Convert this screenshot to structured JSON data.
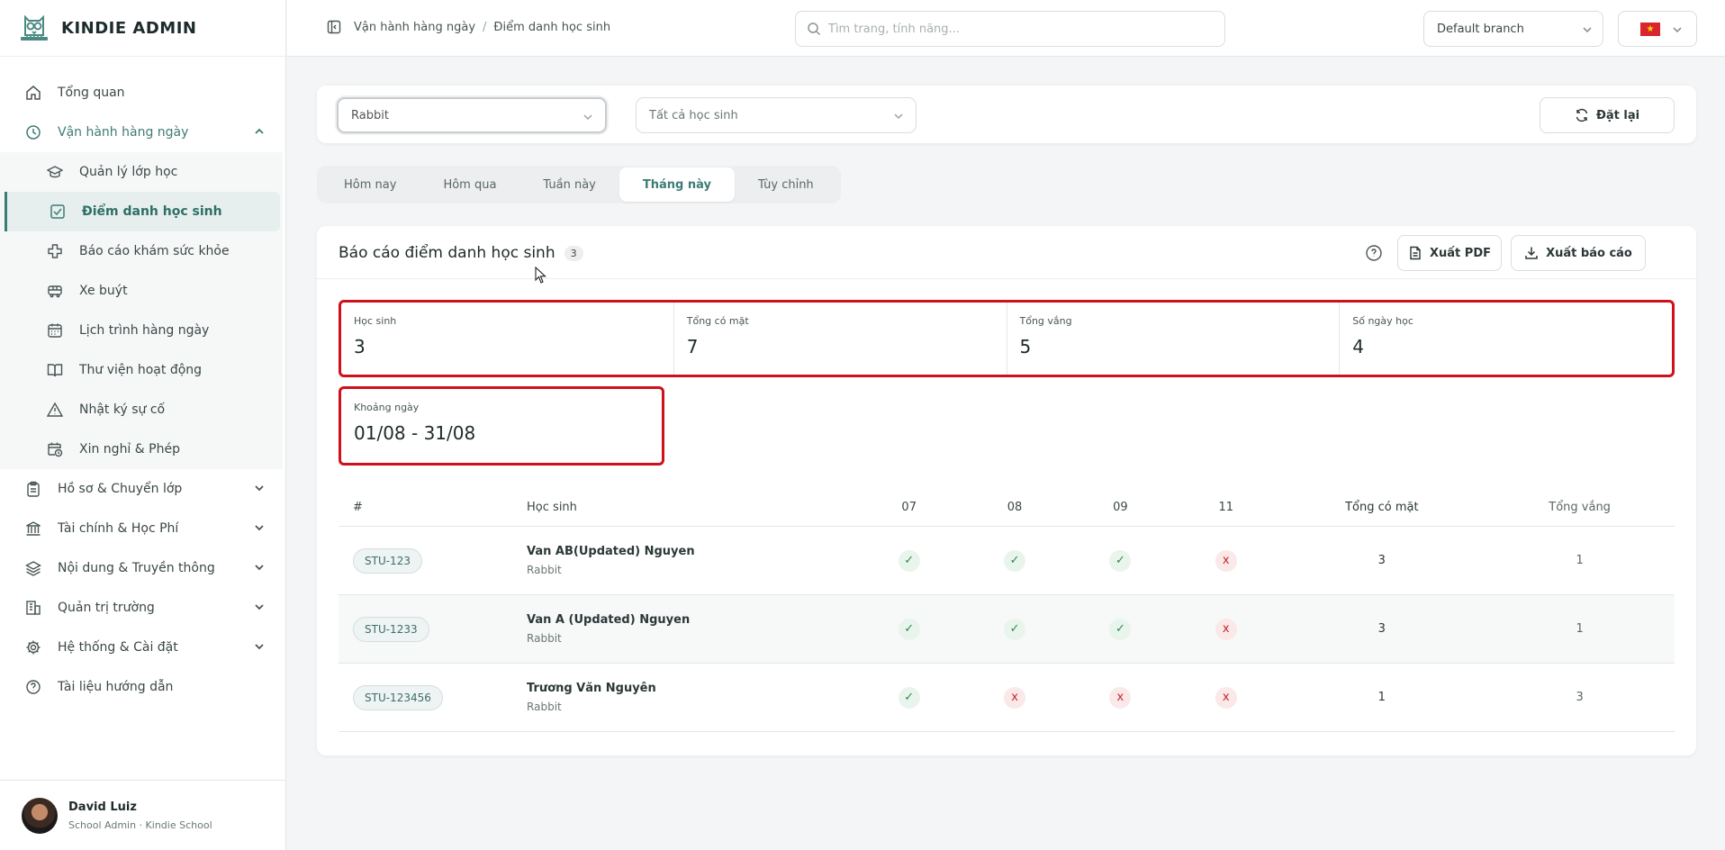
{
  "brand": {
    "name": "KINDIE ADMIN"
  },
  "sidebar": {
    "items": [
      {
        "label": "Tổng quan",
        "icon": "home-icon"
      },
      {
        "label": "Vận hành hàng ngày",
        "icon": "clock-icon",
        "open": true,
        "children": [
          {
            "label": "Quản lý lớp học",
            "icon": "graduation-cap-icon"
          },
          {
            "label": "Điểm danh học sinh",
            "icon": "check-square-icon",
            "active": true
          },
          {
            "label": "Báo cáo khám sức khỏe",
            "icon": "health-cross-icon"
          },
          {
            "label": "Xe buýt",
            "icon": "bus-icon"
          },
          {
            "label": "Lịch trình hàng ngày",
            "icon": "calendar-icon"
          },
          {
            "label": "Thư viện hoạt động",
            "icon": "book-icon"
          },
          {
            "label": "Nhật ký sự cố",
            "icon": "warning-icon"
          },
          {
            "label": "Xin nghỉ & Phép",
            "icon": "calendar-clock-icon"
          }
        ]
      },
      {
        "label": "Hồ sơ & Chuyển lớp",
        "icon": "clipboard-icon"
      },
      {
        "label": "Tài chính & Học Phí",
        "icon": "bank-icon"
      },
      {
        "label": "Nội dung & Truyền thông",
        "icon": "layers-icon"
      },
      {
        "label": "Quản trị trường",
        "icon": "building-icon"
      },
      {
        "label": "Hệ thống & Cài đặt",
        "icon": "gear-icon"
      },
      {
        "label": "Tài liệu hướng dẫn",
        "icon": "help-circle-icon"
      }
    ]
  },
  "user": {
    "name": "David Luiz",
    "role": "School Admin · Kindie School"
  },
  "header": {
    "breadcrumb": [
      "Vận hành hàng ngày",
      "Điểm danh học sinh"
    ],
    "search_placeholder": "Tìm trang, tính năng...",
    "branch": "Default branch",
    "flag_color": "#d8262c"
  },
  "filters": {
    "class_value": "Rabbit",
    "student_value": "Tất cả học sinh",
    "reset_label": "Đặt lại"
  },
  "tabs": [
    {
      "label": "Hôm nay"
    },
    {
      "label": "Hôm qua"
    },
    {
      "label": "Tuần này"
    },
    {
      "label": "Tháng này",
      "active": true
    },
    {
      "label": "Tùy chỉnh"
    }
  ],
  "report": {
    "title": "Báo cáo điểm danh học sinh",
    "count": "3",
    "pdf_label": "Xuất PDF",
    "export_label": "Xuất báo cáo",
    "stats": [
      {
        "label": "Học sinh",
        "value": "3"
      },
      {
        "label": "Tổng có mặt",
        "value": "7"
      },
      {
        "label": "Tổng vắng",
        "value": "5"
      },
      {
        "label": "Số ngày học",
        "value": "4"
      }
    ],
    "range": {
      "label": "Khoảng ngày",
      "value": "01/08 - 31/08"
    },
    "table": {
      "headers": {
        "index": "#",
        "student": "Học sinh",
        "days": [
          "07",
          "08",
          "09",
          "11"
        ],
        "present": "Tổng có mặt",
        "absent": "Tổng vắng"
      },
      "rows": [
        {
          "id": "STU-123",
          "name": "Van AB(Updated) Nguyen",
          "class": "Rabbit",
          "marks": [
            "✓",
            "✓",
            "✓",
            "x"
          ],
          "present": "3",
          "absent": "1"
        },
        {
          "id": "STU-1233",
          "name": "Van A (Updated) Nguyen",
          "class": "Rabbit",
          "marks": [
            "✓",
            "✓",
            "✓",
            "x"
          ],
          "present": "3",
          "absent": "1"
        },
        {
          "id": "STU-123456",
          "name": "Trương Văn Nguyên",
          "class": "Rabbit",
          "marks": [
            "✓",
            "x",
            "x",
            "x"
          ],
          "present": "1",
          "absent": "3"
        }
      ]
    }
  },
  "colors": {
    "accent": "#3d7c74",
    "highlight": "#d0101a",
    "present": "#2a8a4a",
    "absent": "#c6282b"
  }
}
